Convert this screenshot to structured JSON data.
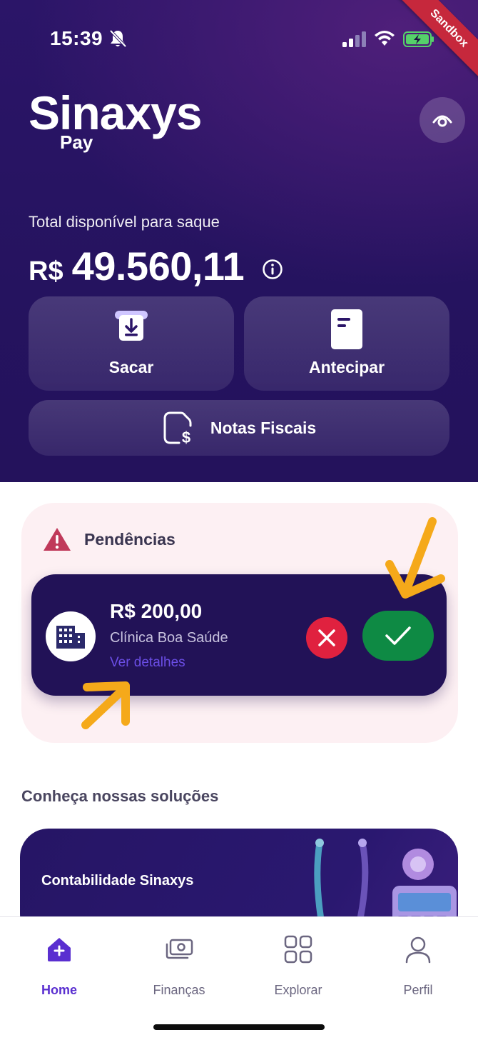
{
  "status_bar": {
    "time": "15:39"
  },
  "environment_badge": "Sandbox",
  "brand": {
    "name": "Sinaxys",
    "sub": "Pay"
  },
  "balance": {
    "label": "Total disponível para saque",
    "currency": "R$",
    "value": "49.560,11"
  },
  "actions": {
    "withdraw": "Sacar",
    "anticipate": "Antecipar",
    "invoices": "Notas Fiscais"
  },
  "pending": {
    "title": "Pendências",
    "item": {
      "amount": "R$ 200,00",
      "clinic": "Clínica Boa Saúde",
      "details_link": "Ver detalhes"
    }
  },
  "solutions": {
    "title": "Conheça nossas soluções",
    "card_title": "Contabilidade Sinaxys"
  },
  "tabs": [
    {
      "label": "Home",
      "icon": "home-icon",
      "active": true
    },
    {
      "label": "Finanças",
      "icon": "money-icon",
      "active": false
    },
    {
      "label": "Explorar",
      "icon": "grid-icon",
      "active": false
    },
    {
      "label": "Perfil",
      "icon": "user-icon",
      "active": false
    }
  ],
  "colors": {
    "hero_bg": "#25135f",
    "accent": "#5a2fd0",
    "reject": "#e0213f",
    "approve": "#0e8a44",
    "warning": "#c0395a",
    "annotation_arrow": "#f5a91a"
  }
}
